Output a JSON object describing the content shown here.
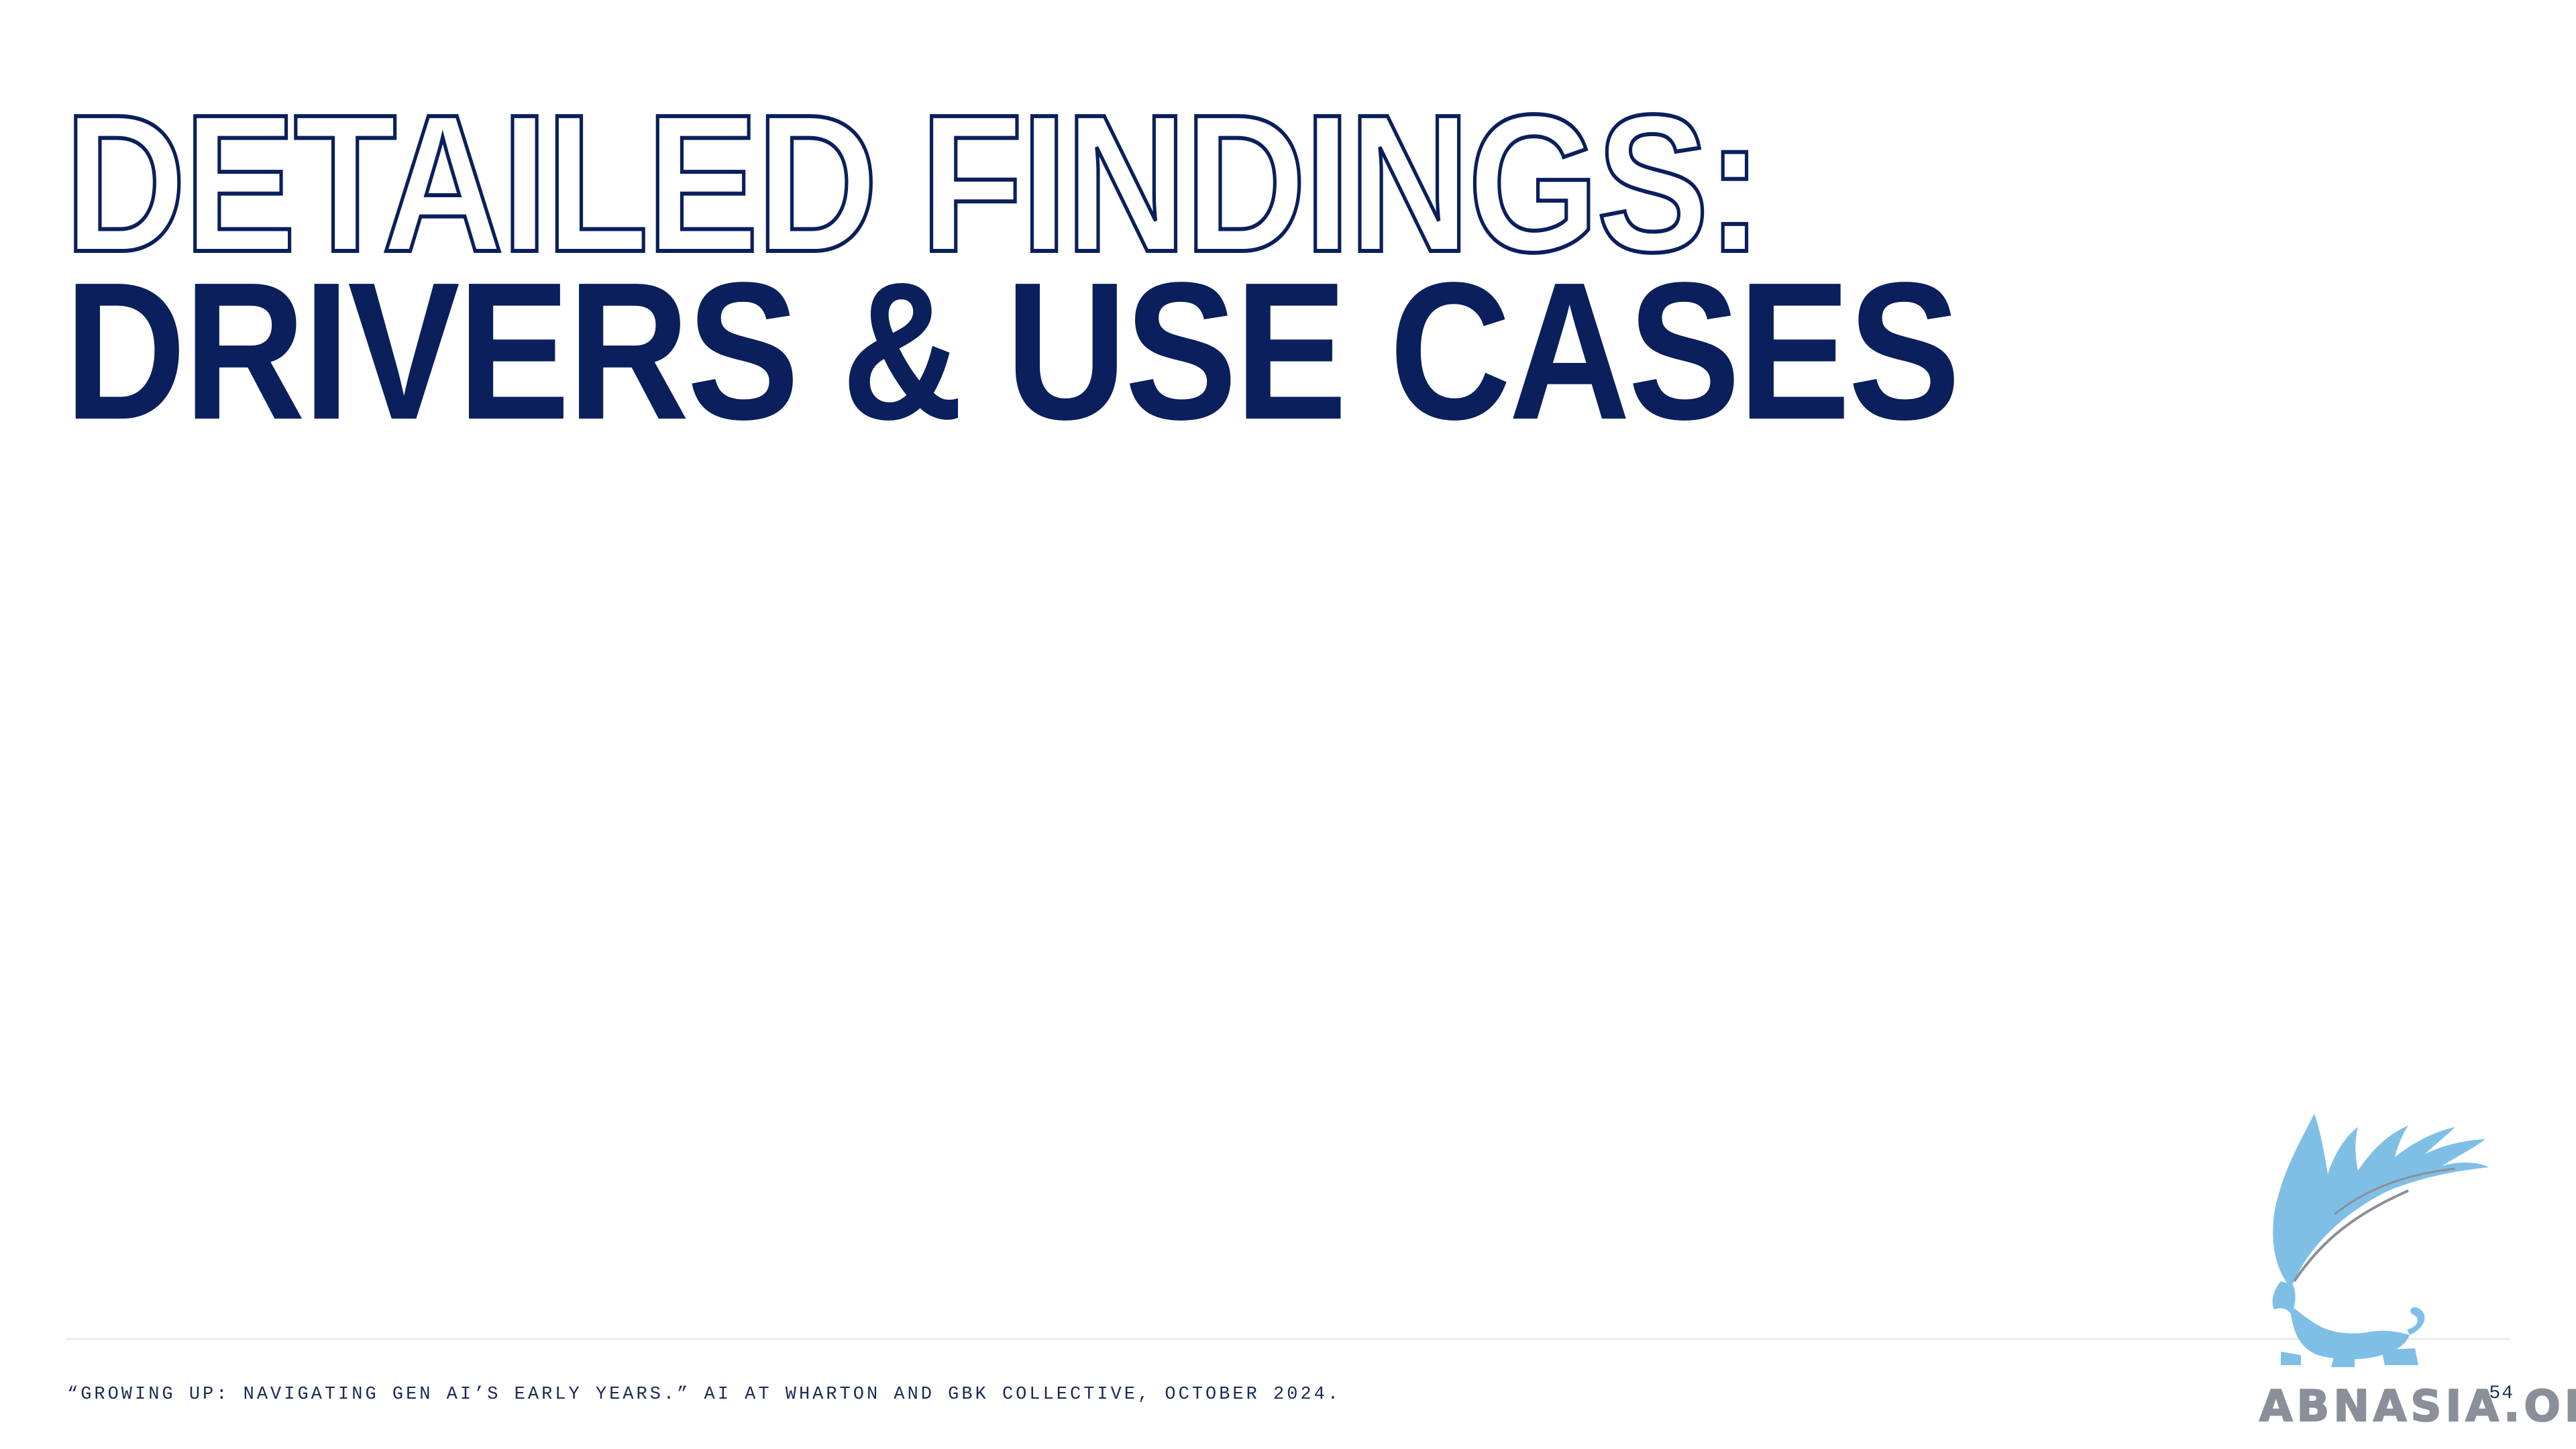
{
  "slide": {
    "title_outline": "DETAILED FINDINGS:",
    "title_solid": "DRIVERS & USE CASES"
  },
  "footer": {
    "citation": "“GROWING UP: NAVIGATING GEN AI’S EARLY YEARS.” AI AT WHARTON AND GBK COLLECTIVE, OCTOBER 2024.",
    "page_number": "54"
  },
  "watermark": {
    "text": "ABNASIA.ORG",
    "icon": "griffin-icon"
  },
  "colors": {
    "navy": "#0a1f5c",
    "watermark_blue": "#7fbfe6",
    "watermark_gray": "#8a8f99"
  }
}
